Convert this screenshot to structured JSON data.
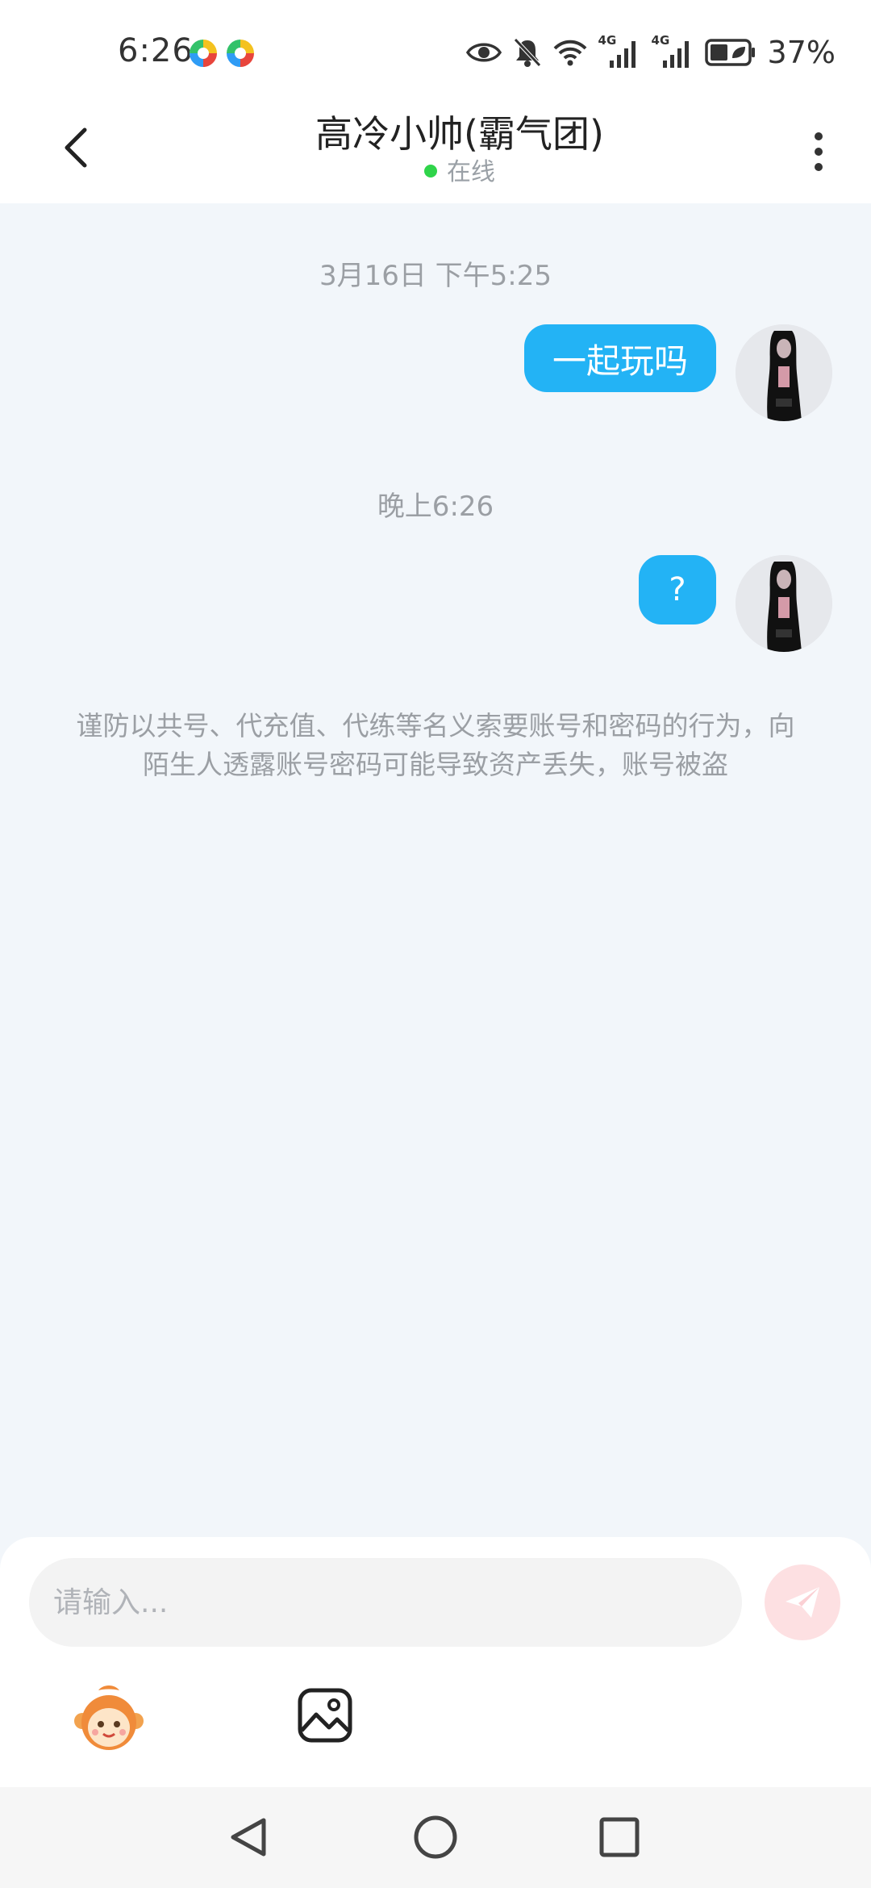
{
  "status_bar": {
    "time": "6:26",
    "signal_left_label": "4G",
    "signal_right_label": "4G",
    "battery": "37%"
  },
  "header": {
    "title": "高冷小帅(霸气团)",
    "status": "在线",
    "status_color": "#2fd44a"
  },
  "messages": [
    {
      "timestamp": "3月16日 下午5:25",
      "text": "一起玩吗",
      "direction": "outgoing"
    },
    {
      "timestamp": "晚上6:26",
      "text": "?",
      "direction": "outgoing"
    }
  ],
  "warning": "谨防以共号、代充值、代练等名义索要账号和密码的行为，向陌生人透露账号密码可能导致资产丢失，账号被盗",
  "input": {
    "placeholder": "请输入..."
  },
  "colors": {
    "accent": "#23b3f5",
    "send_button": "#fde0e2",
    "background": "#f2f6fa"
  },
  "icons": [
    "back-icon",
    "more-icon",
    "send-icon",
    "emoji-icon",
    "image-icon",
    "nav-back-icon",
    "nav-home-icon",
    "nav-recents-icon"
  ]
}
